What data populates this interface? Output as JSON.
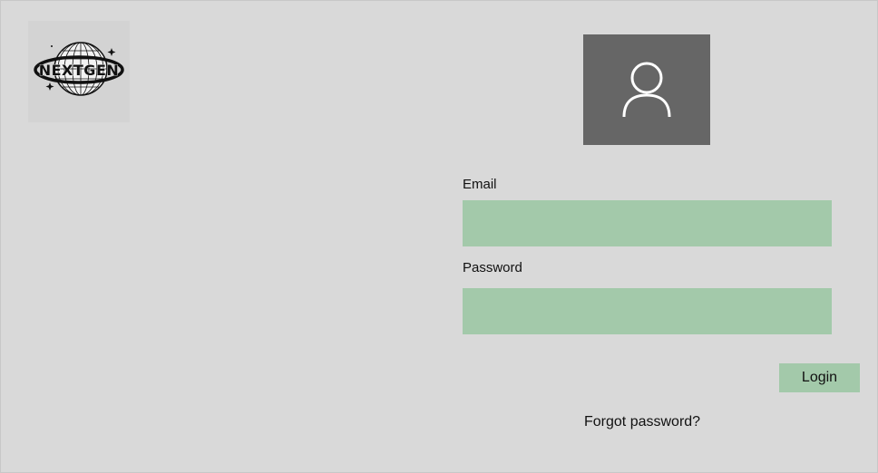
{
  "logo": {
    "text": "NEXTGEN",
    "icon": "globe-logo-icon"
  },
  "avatar": {
    "icon": "user-icon"
  },
  "form": {
    "email_label": "Email",
    "email_value": "",
    "password_label": "Password",
    "password_value": "",
    "login_label": "Login",
    "forgot_label": "Forgot password?"
  },
  "colors": {
    "background": "#d9d9d9",
    "field": "#a3c9aa",
    "avatar_bg": "#666666"
  }
}
